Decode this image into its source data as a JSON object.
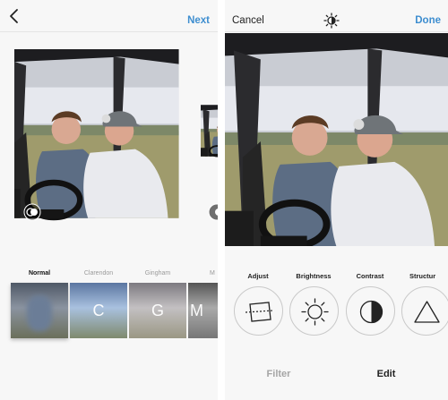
{
  "left_screen": {
    "header": {
      "back_icon": "chevron-left-icon",
      "next_label": "Next"
    },
    "photo_tool_icon": "edit-overlay-icon",
    "filters": [
      {
        "label": "Normal",
        "selected": true,
        "thumb_letter": ""
      },
      {
        "label": "Clarendon",
        "selected": false,
        "thumb_letter": "C"
      },
      {
        "label": "Gingham",
        "selected": false,
        "thumb_letter": "G"
      },
      {
        "label": "M",
        "selected": false,
        "thumb_letter": "M"
      }
    ]
  },
  "right_screen": {
    "header": {
      "cancel_label": "Cancel",
      "title_icon": "lux-icon",
      "done_label": "Done"
    },
    "tools": [
      {
        "label": "Adjust",
        "icon": "adjust-icon"
      },
      {
        "label": "Brightness",
        "icon": "brightness-icon"
      },
      {
        "label": "Contrast",
        "icon": "contrast-icon"
      },
      {
        "label": "Structur",
        "icon": "structure-icon"
      }
    ],
    "tabs": {
      "filter": "Filter",
      "edit": "Edit",
      "active": "Edit"
    }
  },
  "colors": {
    "accent": "#3e8ed0",
    "background": "#f7f7f7",
    "divider": "#e4e4e4"
  }
}
